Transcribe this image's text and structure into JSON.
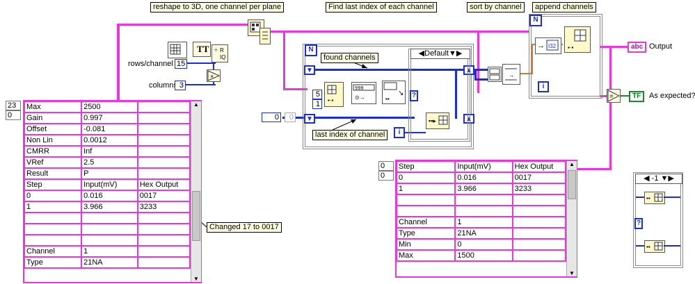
{
  "labels": {
    "reshape": "reshape to 3D, one channel per plane",
    "find_last": "Find last index of each channel",
    "sort": "sort by channel",
    "append": "append channels",
    "found": "found channels",
    "last_index": "last index of channel",
    "changed": "Changed 17 to 0017"
  },
  "controls": {
    "rows_per_channel_label": "rows/channel",
    "rows_per_channel_value": "15",
    "columns_label": "columns",
    "columns_value": "3",
    "shift_const": "0",
    "shift_const2": "0",
    "const_5": "5",
    "const_1": "1",
    "index_n": "N",
    "index_i": "i"
  },
  "case_structure": {
    "selector": "Default"
  },
  "case_structure_small": {
    "selector": "-1"
  },
  "outputs": {
    "output_label": "Output",
    "output_type": "abc",
    "expected_label": "As expected?",
    "expected_type": "TF"
  },
  "left_array": {
    "index_row": "23",
    "index_col": "0",
    "rows": [
      [
        "Max",
        "2500",
        ""
      ],
      [
        "Gain",
        "0.997",
        ""
      ],
      [
        "Offset",
        "-0.081",
        ""
      ],
      [
        "Non Lin",
        "0.0012",
        ""
      ],
      [
        "CMRR",
        "Inf",
        ""
      ],
      [
        "VRef",
        "2.5",
        ""
      ],
      [
        "Result",
        "P",
        ""
      ],
      [
        "Step",
        "Input(mV)",
        "Hex Output"
      ],
      [
        "0",
        "0.016",
        "0017"
      ],
      [
        "1",
        "3.966",
        "3233"
      ],
      [
        "",
        "",
        ""
      ],
      [
        "",
        "",
        ""
      ],
      [
        "",
        "",
        ""
      ],
      [
        "Channel",
        "1",
        ""
      ],
      [
        "Type",
        "21NA",
        ""
      ]
    ]
  },
  "right_array": {
    "index_row": "0",
    "index_col": "0",
    "rows": [
      [
        "Step",
        "Input(mV)",
        "Hex Output"
      ],
      [
        "0",
        "0.016",
        "0017"
      ],
      [
        "1",
        "3.966",
        "3233"
      ],
      [
        "",
        "",
        ""
      ],
      [
        "",
        "",
        ""
      ],
      [
        "Channel",
        "1",
        ""
      ],
      [
        "Type",
        "21NA",
        ""
      ],
      [
        "Min",
        "0",
        ""
      ],
      [
        "Max",
        "1500",
        ""
      ]
    ]
  },
  "colors": {
    "string_wire": "#ee33e0",
    "int_wire": "#1a2ce0",
    "bool_wire": "#1a8a2a",
    "annotation": "#ffffe1"
  }
}
